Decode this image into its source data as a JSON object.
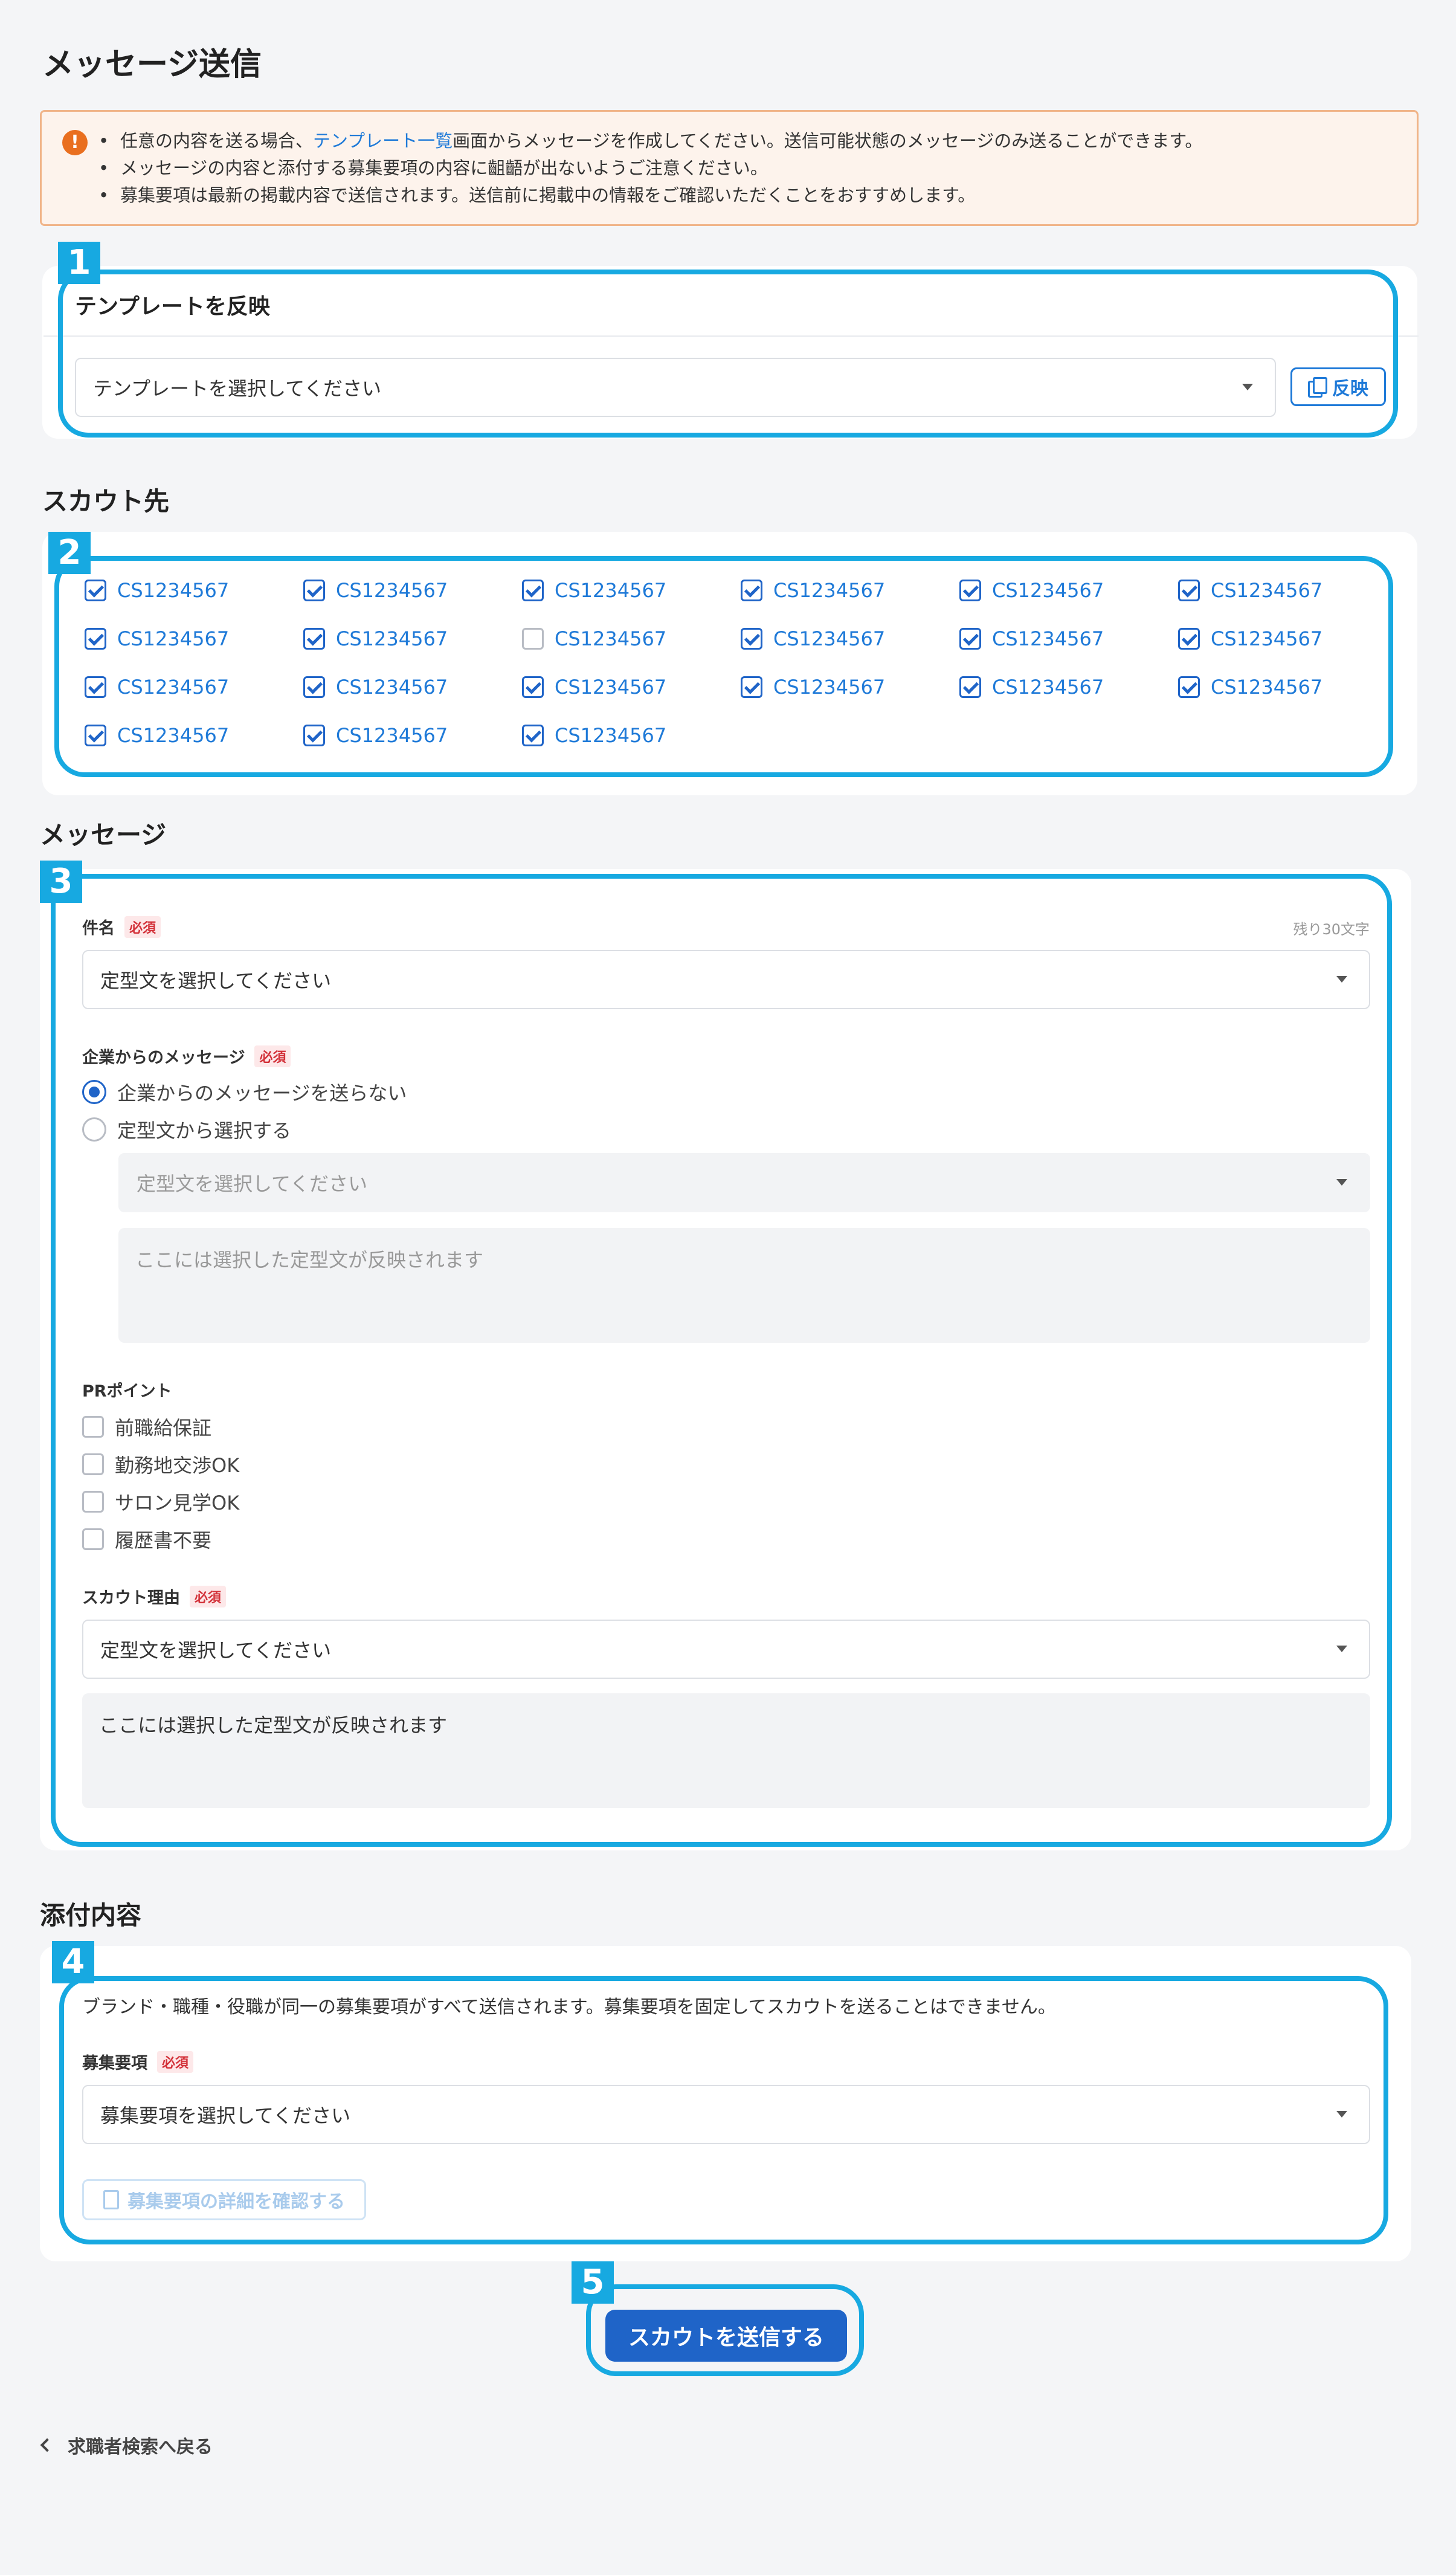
{
  "page_title": "メッセージ送信",
  "notice": {
    "line1_pre": "任意の内容を送る場合、",
    "line1_link": "テンプレート一覧",
    "line1_post": "画面からメッセージを作成してください。送信可能状態のメッセージのみ送ることができます。",
    "line2": "メッセージの内容と添付する募集要項の内容に齟齬が出ないようご注意ください。",
    "line3": "募集要項は最新の掲載内容で送信されます。送信前に掲載中の情報をご確認いただくことをおすすめします。"
  },
  "annotations": [
    "1",
    "2",
    "3",
    "4",
    "5"
  ],
  "template": {
    "title": "テンプレートを反映",
    "placeholder": "テンプレートを選択してください",
    "apply_label": "反映"
  },
  "scout": {
    "title": "スカウト先",
    "candidates": [
      {
        "id": "CS1234567",
        "checked": true
      },
      {
        "id": "CS1234567",
        "checked": true
      },
      {
        "id": "CS1234567",
        "checked": true
      },
      {
        "id": "CS1234567",
        "checked": true
      },
      {
        "id": "CS1234567",
        "checked": true
      },
      {
        "id": "CS1234567",
        "checked": true
      },
      {
        "id": "CS1234567",
        "checked": true
      },
      {
        "id": "CS1234567",
        "checked": true
      },
      {
        "id": "CS1234567",
        "checked": false
      },
      {
        "id": "CS1234567",
        "checked": true
      },
      {
        "id": "CS1234567",
        "checked": true
      },
      {
        "id": "CS1234567",
        "checked": true
      },
      {
        "id": "CS1234567",
        "checked": true
      },
      {
        "id": "CS1234567",
        "checked": true
      },
      {
        "id": "CS1234567",
        "checked": true
      },
      {
        "id": "CS1234567",
        "checked": true
      },
      {
        "id": "CS1234567",
        "checked": true
      },
      {
        "id": "CS1234567",
        "checked": true
      },
      {
        "id": "CS1234567",
        "checked": true
      },
      {
        "id": "CS1234567",
        "checked": true
      },
      {
        "id": "CS1234567",
        "checked": true
      }
    ]
  },
  "message": {
    "title": "メッセージ",
    "required": "必須",
    "subject_label": "件名",
    "subject_counter": "残り30文字",
    "subject_placeholder": "定型文を選択してください",
    "company_label": "企業からのメッセージ",
    "company_options": [
      "企業からのメッセージを送らない",
      "定型文から選択する"
    ],
    "company_selected": 0,
    "company_select_placeholder": "定型文を選択してください",
    "company_preview": "ここには選択した定型文が反映されます",
    "pr_label": "PRポイント",
    "pr_options": [
      "前職給保証",
      "勤務地交渉OK",
      "サロン見学OK",
      "履歴書不要"
    ],
    "reason_label": "スカウト理由",
    "reason_placeholder": "定型文を選択してください",
    "reason_preview": "ここには選択した定型文が反映されます"
  },
  "attachment": {
    "title": "添付内容",
    "note": "ブランド・職種・役職が同一の募集要項がすべて送信されます。募集要項を固定してスカウトを送ることはできません。",
    "label": "募集要項",
    "placeholder": "募集要項を選択してください",
    "detail_button": "募集要項の詳細を確認する"
  },
  "submit_label": "スカウトを送信する",
  "back_label": "求職者検索へ戻る",
  "colors": {
    "accent": "#17a9e1",
    "primary": "#1f64c8",
    "link": "#1f7ad8",
    "required": "#d3323a",
    "warning": "#e96f1f"
  }
}
